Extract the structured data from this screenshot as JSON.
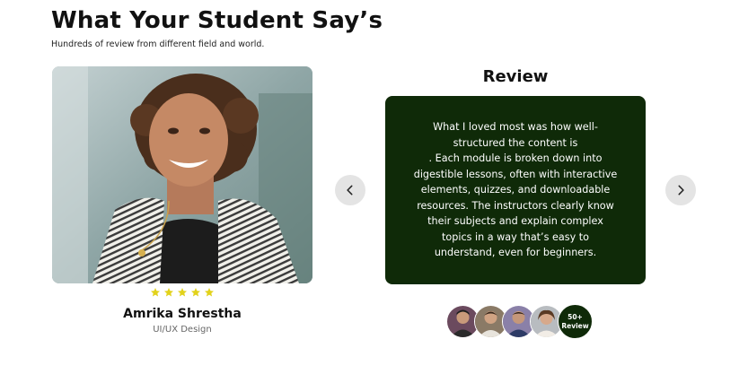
{
  "section": {
    "title": "What Your Student Say’s",
    "subtitle": "Hundreds of review from different field and world."
  },
  "testimonial": {
    "name": "Amrika Shrestha",
    "role": "UI/UX Design",
    "rating": 5,
    "max_rating": 5,
    "photo_icon": "portrait-photo"
  },
  "review": {
    "heading": "Review",
    "text": "What I loved most was how well-\nstructured the content is\n. Each module is broken down into\ndigestible lessons, often with interactive\nelements, quizzes, and downloadable\nresources. The instructors clearly know\ntheir subjects and explain complex\ntopics in a way that’s easy to\nunderstand, even for beginners."
  },
  "navigation": {
    "prev_icon": "chevron-left-icon",
    "next_icon": "chevron-right-icon"
  },
  "reviewers": {
    "count_number": "50+",
    "count_label": "Review"
  },
  "colors": {
    "card_background": "#0f2a08",
    "star": "#e2d21b",
    "nav_button": "#e4e4e4"
  }
}
